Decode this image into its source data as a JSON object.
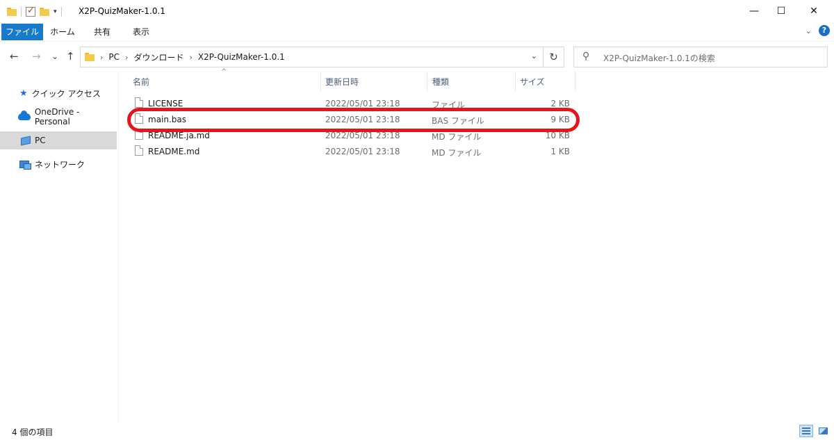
{
  "window": {
    "title": "X2P-QuizMaker-1.0.1",
    "controls": {
      "minimize": "—",
      "maximize": "☐",
      "close": "✕"
    }
  },
  "quick_access": {
    "dropdown": "▾"
  },
  "ribbon": {
    "tabs": [
      "ファイル",
      "ホーム",
      "共有",
      "表示"
    ],
    "expand": "⌄",
    "help": "?"
  },
  "navigation": {
    "back": "←",
    "forward": "→",
    "recent": "⌄",
    "up": "↑"
  },
  "address": {
    "crumbs": [
      "PC",
      "ダウンロード",
      "X2P-QuizMaker-1.0.1"
    ],
    "separator": "›",
    "dropdown": "⌄",
    "refresh": "↻"
  },
  "search": {
    "placeholder": "X2P-QuizMaker-1.0.1の検索",
    "icon": "⚲"
  },
  "sidebar": {
    "items": [
      {
        "label": "クイック アクセス",
        "icon": "star-icon"
      },
      {
        "label": "OneDrive - Personal",
        "icon": "cloud-icon"
      },
      {
        "label": "PC",
        "icon": "pc-icon",
        "selected": true
      },
      {
        "label": "ネットワーク",
        "icon": "network-icon"
      }
    ]
  },
  "columns": {
    "name": "名前",
    "date": "更新日時",
    "type": "種類",
    "size": "サイズ",
    "sort_indicator": "^"
  },
  "files": [
    {
      "name": "LICENSE",
      "date": "2022/05/01 23:18",
      "type": "ファイル",
      "size": "2 KB"
    },
    {
      "name": "main.bas",
      "date": "2022/05/01 23:18",
      "type": "BAS ファイル",
      "size": "9 KB"
    },
    {
      "name": "README.ja.md",
      "date": "2022/05/01 23:18",
      "type": "MD ファイル",
      "size": "10 KB"
    },
    {
      "name": "README.md",
      "date": "2022/05/01 23:18",
      "type": "MD ファイル",
      "size": "1 KB"
    }
  ],
  "status": {
    "item_count": "4 個の項目"
  },
  "colors": {
    "accent": "#1979ca",
    "highlight": "#e8141c",
    "selected_nav": "#d9d9d9"
  }
}
